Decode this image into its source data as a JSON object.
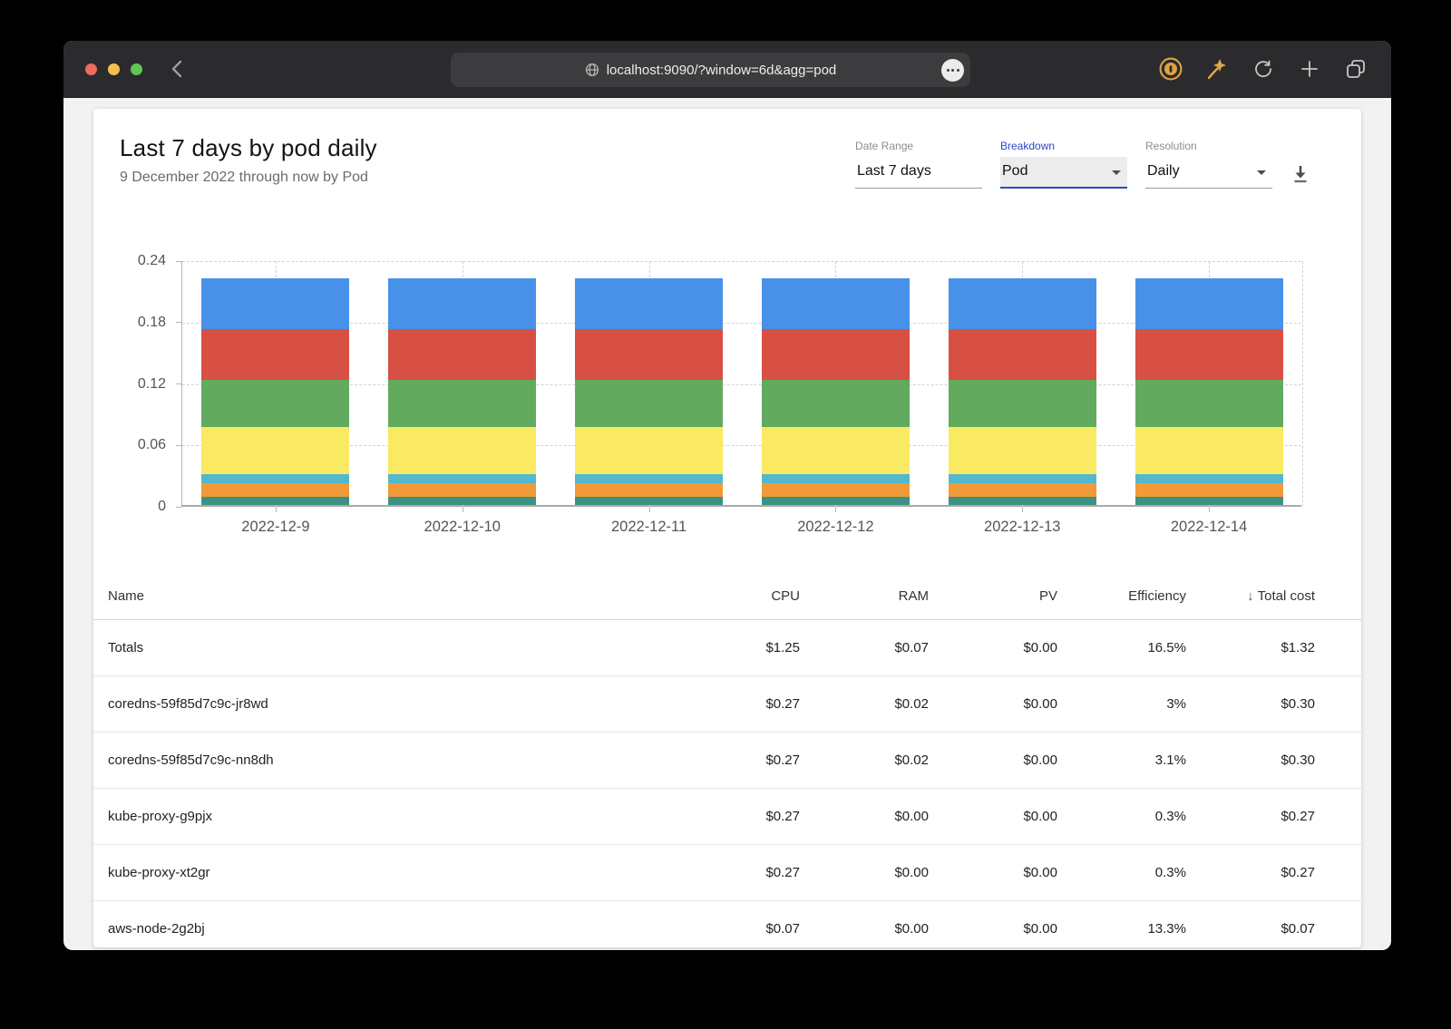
{
  "browser": {
    "url": "localhost:9090/?window=6d&agg=pod"
  },
  "header": {
    "title": "Last 7 days by pod daily",
    "subtitle": "9 December 2022 through now by Pod"
  },
  "controls": {
    "accent_color": "#2f46c8",
    "date_range": {
      "label": "Date Range",
      "value": "Last 7 days"
    },
    "breakdown": {
      "label": "Breakdown",
      "value": "Pod"
    },
    "resolution": {
      "label": "Resolution",
      "value": "Daily"
    }
  },
  "chart_data": {
    "type": "bar",
    "stacked": true,
    "title": "",
    "xlabel": "",
    "ylabel": "",
    "ylim": [
      0,
      0.24
    ],
    "yticks": [
      0,
      0.06,
      0.12,
      0.18,
      0.24
    ],
    "grid": "dashed",
    "legend": false,
    "categories": [
      "2022-12-9",
      "2022-12-10",
      "2022-12-11",
      "2022-12-12",
      "2022-12-13",
      "2022-12-14"
    ],
    "series": [
      {
        "name": "teal-segment",
        "color": "#3d9183",
        "values": [
          0.008,
          0.008,
          0.008,
          0.008,
          0.008,
          0.008
        ]
      },
      {
        "name": "orange-segment",
        "color": "#f09a38",
        "values": [
          0.0133,
          0.0133,
          0.0133,
          0.0133,
          0.0133,
          0.0133
        ]
      },
      {
        "name": "cyan-segment",
        "color": "#54b8cd",
        "values": [
          0.009,
          0.009,
          0.009,
          0.009,
          0.009,
          0.009
        ]
      },
      {
        "name": "yellow-segment",
        "color": "#fae962",
        "values": [
          0.046,
          0.046,
          0.046,
          0.046,
          0.046,
          0.046
        ]
      },
      {
        "name": "green-segment",
        "color": "#62aa5e",
        "values": [
          0.046,
          0.046,
          0.046,
          0.046,
          0.046,
          0.046
        ]
      },
      {
        "name": "red-segment",
        "color": "#d85043",
        "values": [
          0.0495,
          0.0495,
          0.0495,
          0.0495,
          0.0495,
          0.0495
        ]
      },
      {
        "name": "blue-segment",
        "color": "#4791e9",
        "values": [
          0.0495,
          0.0495,
          0.0495,
          0.0495,
          0.0495,
          0.0495
        ]
      }
    ]
  },
  "table": {
    "columns": [
      "Name",
      "CPU",
      "RAM",
      "PV",
      "Efficiency",
      "Total cost"
    ],
    "sort": {
      "column": "Total cost",
      "direction": "desc",
      "arrow": "↓"
    },
    "rows": [
      {
        "name": "Totals",
        "cpu": "$1.25",
        "ram": "$0.07",
        "pv": "$0.00",
        "efficiency": "16.5%",
        "total": "$1.32"
      },
      {
        "name": "coredns-59f85d7c9c-jr8wd",
        "cpu": "$0.27",
        "ram": "$0.02",
        "pv": "$0.00",
        "efficiency": "3%",
        "total": "$0.30"
      },
      {
        "name": "coredns-59f85d7c9c-nn8dh",
        "cpu": "$0.27",
        "ram": "$0.02",
        "pv": "$0.00",
        "efficiency": "3.1%",
        "total": "$0.30"
      },
      {
        "name": "kube-proxy-g9pjx",
        "cpu": "$0.27",
        "ram": "$0.00",
        "pv": "$0.00",
        "efficiency": "0.3%",
        "total": "$0.27"
      },
      {
        "name": "kube-proxy-xt2gr",
        "cpu": "$0.27",
        "ram": "$0.00",
        "pv": "$0.00",
        "efficiency": "0.3%",
        "total": "$0.27"
      },
      {
        "name": "aws-node-2g2bj",
        "cpu": "$0.07",
        "ram": "$0.00",
        "pv": "$0.00",
        "efficiency": "13.3%",
        "total": "$0.07"
      }
    ]
  }
}
